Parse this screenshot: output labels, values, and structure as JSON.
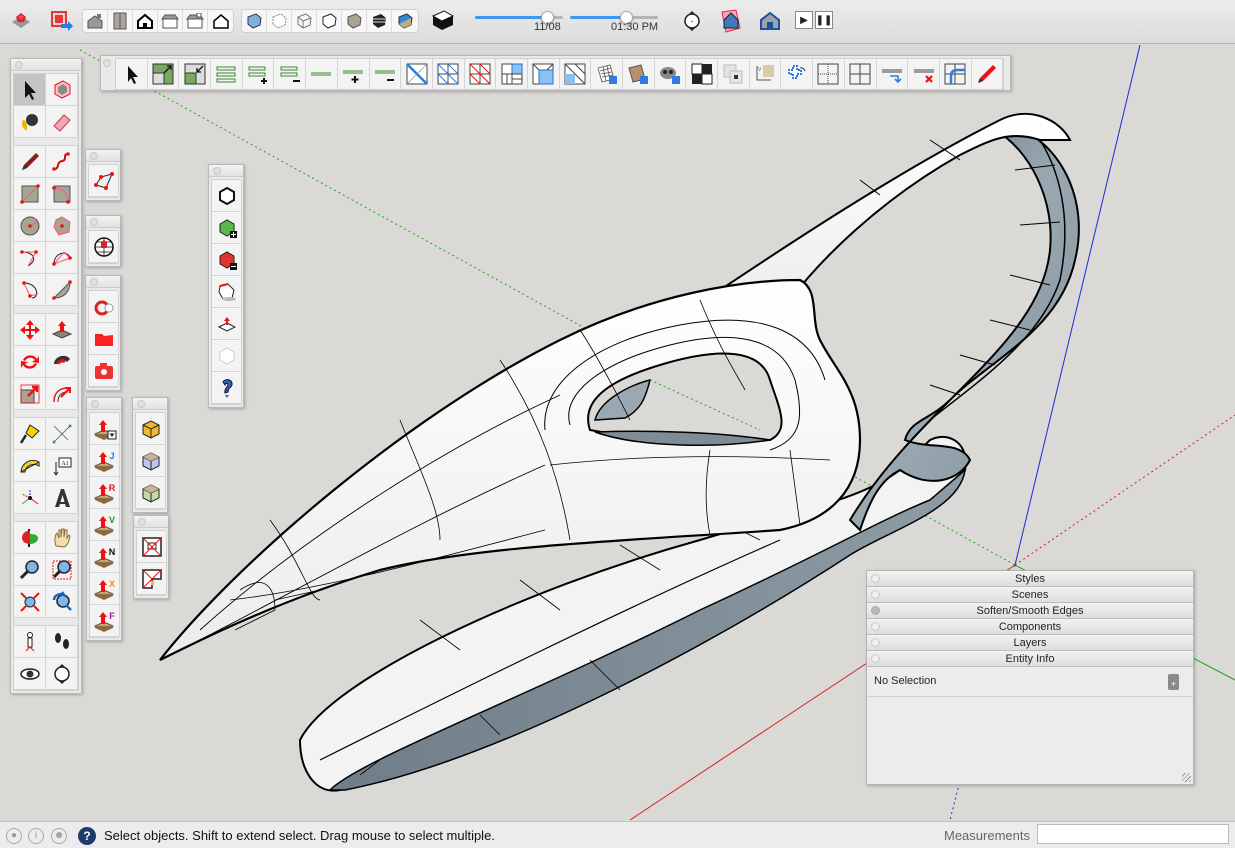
{
  "top_toolbar": {
    "icons_left": [
      "extension-warehouse-icon",
      "send-to-layout-icon"
    ],
    "views_group": [
      "iso-view-icon",
      "top-view-icon",
      "front-view-icon",
      "right-view-icon",
      "back-view-icon",
      "left-view-icon"
    ],
    "styles_group": [
      "xray-icon",
      "back-edges-icon",
      "wireframe-icon",
      "hidden-line-icon",
      "shaded-icon",
      "shaded-textures-icon",
      "monochrome-icon"
    ],
    "section_icon": "section-plane-icon",
    "date_label": "11/08",
    "date_value_fraction": 0.82,
    "time_label": "01:30 PM",
    "time_value_fraction": 0.64,
    "icons_right": [
      "position-camera-icon",
      "geo-location-icon",
      "model-info-icon"
    ],
    "play_label": "▶",
    "pause_label": "❚❚"
  },
  "main_toolbar": {
    "tools": [
      "select",
      "scale-up",
      "scale-down",
      "loops",
      "add-loop",
      "remove-loop",
      "edge",
      "add-edge",
      "remove-edge",
      "diagonal",
      "grid-diagonal",
      "red-diagonal",
      "subdivide-corner",
      "subdivide-frame",
      "triangulate",
      "uv-grid",
      "uv-texture",
      "uv-monkey",
      "checker",
      "copy-uv",
      "uv-swap",
      "unfold",
      "grid-dotted",
      "grid-split",
      "edge-move",
      "edge-delete",
      "round-corner",
      "pencil-draw"
    ]
  },
  "left_palette": {
    "groups": [
      [
        "select",
        "component",
        "paint-bucket",
        "eraser"
      ],
      [
        "pencil",
        "freehand",
        "rectangle",
        "rotated-rectangle",
        "circle",
        "polygon",
        "arc",
        "two-point-arc",
        "three-point-arc",
        "pie"
      ],
      [
        "move",
        "push-pull",
        "rotate",
        "follow-me",
        "scale",
        "offset"
      ],
      [
        "tape-measure",
        "dimension",
        "protractor",
        "text",
        "axes",
        "3d-text"
      ],
      [
        "orbit",
        "pan",
        "zoom",
        "zoom-window",
        "zoom-extents",
        "previous-view"
      ],
      [
        "position-camera",
        "walk",
        "look-around",
        "section"
      ]
    ]
  },
  "floating_palettes": {
    "polygon": [
      "polygon-tool"
    ],
    "globe": [
      "geo-globe"
    ],
    "files": [
      "extension-manager",
      "open-folder",
      "camera-snapshot"
    ],
    "pushpull_variants": [
      "joint-pushpull-dropdown",
      "joint-pushpull-J",
      "pushpull-R",
      "pushpull-V",
      "pushpull-N",
      "pushpull-X",
      "pushpull-F"
    ],
    "pushpull_letters": [
      "",
      "J",
      "R",
      "V",
      "N",
      "X",
      "F"
    ],
    "round_corner": [
      "round-corner-orange",
      "round-corner-blue",
      "round-corner-green"
    ],
    "quad_tools": [
      "quad-frame",
      "quad-corner"
    ],
    "solid_tools": [
      "outer-shell",
      "union",
      "subtract",
      "trim",
      "split",
      "intersect",
      "help"
    ]
  },
  "tray": {
    "panels": [
      {
        "label": "Styles",
        "active": false
      },
      {
        "label": "Scenes",
        "active": false
      },
      {
        "label": "Soften/Smooth Edges",
        "active": true
      },
      {
        "label": "Components",
        "active": false
      },
      {
        "label": "Layers",
        "active": false
      },
      {
        "label": "Entity Info",
        "active": false
      }
    ],
    "entity_info": {
      "selection": "No Selection"
    }
  },
  "status_bar": {
    "icons": [
      "geo-location-status-icon",
      "info-status-icon",
      "user-status-icon"
    ],
    "help_label": "?",
    "message": "Select objects. Shift to extend select. Drag mouse to select multiple.",
    "measurements_label": "Measurements",
    "measurements_value": ""
  },
  "colors": {
    "accent_blue": "#3d97f0",
    "axis_red": "#d42020",
    "axis_green": "#1fa51f",
    "axis_blue": "#1d2ad8",
    "background": "#dad9d5",
    "face_back": "#8d9aa4"
  }
}
